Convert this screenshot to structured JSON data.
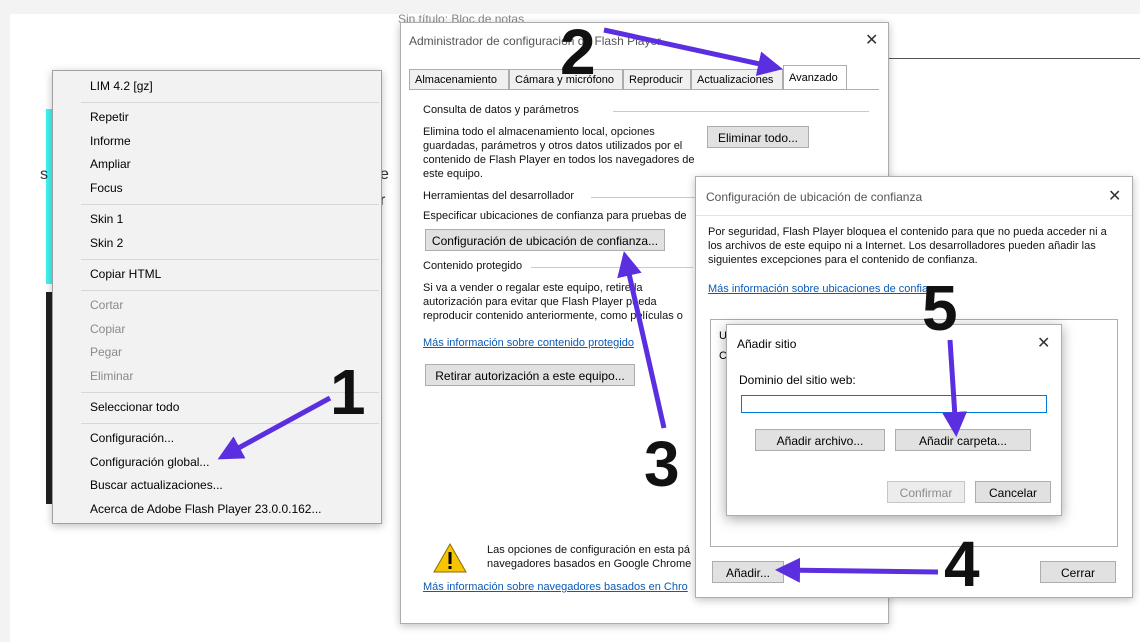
{
  "background": {
    "notepad_title": "Sin título: Bloc de notas",
    "cyan_color": "#3ff5f4"
  },
  "context_menu": {
    "items": [
      {
        "label": "LIM 4.2   [gz]",
        "enabled": true
      },
      {
        "label": "Repetir",
        "enabled": true
      },
      {
        "label": "Informe",
        "enabled": true
      },
      {
        "label": "Ampliar",
        "enabled": true
      },
      {
        "label": "Focus",
        "enabled": true
      },
      {
        "label": "Skin 1",
        "enabled": true
      },
      {
        "label": "Skin 2",
        "enabled": true
      },
      {
        "label": "Copiar HTML",
        "enabled": true
      },
      {
        "label": "Cortar",
        "enabled": false
      },
      {
        "label": "Copiar",
        "enabled": false
      },
      {
        "label": "Pegar",
        "enabled": false
      },
      {
        "label": "Eliminar",
        "enabled": false
      },
      {
        "label": "Seleccionar todo",
        "enabled": true
      },
      {
        "label": "Configuración...",
        "enabled": true
      },
      {
        "label": "Configuración global...",
        "enabled": true
      },
      {
        "label": "Buscar actualizaciones...",
        "enabled": true
      },
      {
        "label": "Acerca de Adobe Flash Player 23.0.0.162...",
        "enabled": true
      }
    ]
  },
  "flash_manager": {
    "title": "Administrador de configuración de Flash Player",
    "close": "✕",
    "tabs": [
      "Almacenamiento",
      "Cámara y micrófono",
      "Reproducir",
      "Actualizaciones",
      "Avanzado"
    ],
    "active_tab": "Avanzado",
    "section_data": "Consulta de datos y parámetros",
    "data_text": "Elimina todo el almacenamiento local, opciones guardadas, parámetros y otros datos utilizados por el contenido de Flash Player en todos los navegadores de este equipo.",
    "delete_all": "Eliminar todo...",
    "section_dev": "Herramientas del desarrollador",
    "dev_text": "Especificar ubicaciones de confianza para pruebas de",
    "trusted_btn": "Configuración de ubicación de confianza...",
    "section_protected": "Contenido protegido",
    "protected_text": "Si va a vender o regalar este equipo, retire la autorización para evitar que Flash Player pueda reproducir contenido anteriormente, como películas o música comprada.",
    "protected_link": "Más información sobre contenido protegido",
    "deauth_btn": "Retirar autorización a este equipo...",
    "footer_text": "Las opciones de configuración en esta pá navegadores basados en Google Chrome",
    "footer_link": "Más información sobre navegadores basados en Chro"
  },
  "trust_dialog": {
    "title": "Configuración de ubicación de confianza",
    "close": "✕",
    "text": "Por seguridad, Flash Player bloquea el contenido para que no pueda acceder ni a los archivos de este equipo ni a Internet. Los desarrolladores pueden añadir las siguientes excepciones para el contenido de confianza.",
    "link": "Más información sobre ubicaciones de confia",
    "list_partial_1": "U",
    "list_partial_2": "C",
    "add_btn": "Añadir...",
    "close_btn": "Cerrar"
  },
  "add_site": {
    "title": "Añadir sitio",
    "close": "✕",
    "label": "Dominio del sitio web:",
    "input_value": "",
    "add_file": "Añadir archivo...",
    "add_folder": "Añadir carpeta...",
    "confirm": "Confirmar",
    "cancel": "Cancelar"
  },
  "annotations": {
    "n1": "1",
    "n2": "2",
    "n3": "3",
    "n4": "4",
    "n5": "5",
    "arrow_color": "#5b2ee0"
  }
}
